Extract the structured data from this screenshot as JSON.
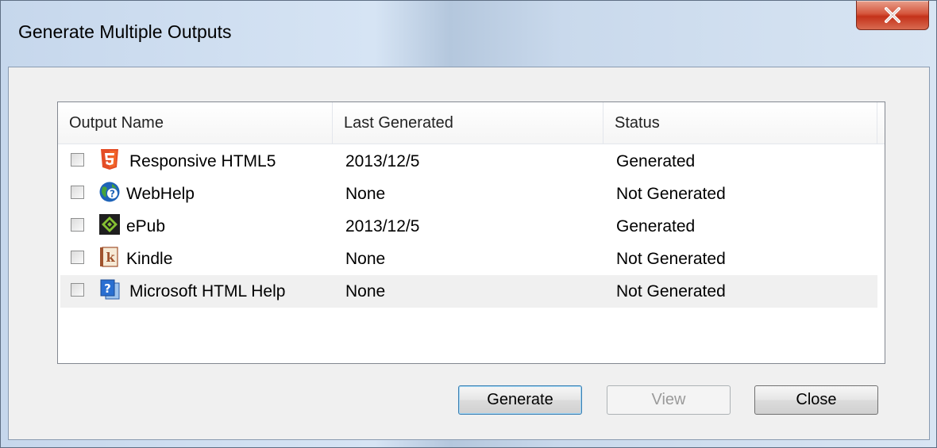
{
  "window": {
    "title": "Generate Multiple Outputs",
    "close_symbol": "X"
  },
  "list": {
    "columns": [
      "Output Name",
      "Last Generated",
      "Status"
    ],
    "rows": [
      {
        "name": "Responsive HTML5",
        "last_generated": "2013/12/5",
        "status": "Generated",
        "icon": "html5-icon",
        "checked": false
      },
      {
        "name": "WebHelp",
        "last_generated": "None",
        "status": "Not Generated",
        "icon": "webhelp-icon",
        "checked": false
      },
      {
        "name": "ePub",
        "last_generated": "2013/12/5",
        "status": "Generated",
        "icon": "epub-icon",
        "checked": false
      },
      {
        "name": "Kindle",
        "last_generated": "None",
        "status": "Not Generated",
        "icon": "kindle-icon",
        "checked": false
      },
      {
        "name": "Microsoft HTML Help",
        "last_generated": "None",
        "status": "Not Generated",
        "icon": "html-help-icon",
        "checked": false
      }
    ]
  },
  "buttons": {
    "generate": "Generate",
    "view": "View",
    "close": "Close"
  }
}
